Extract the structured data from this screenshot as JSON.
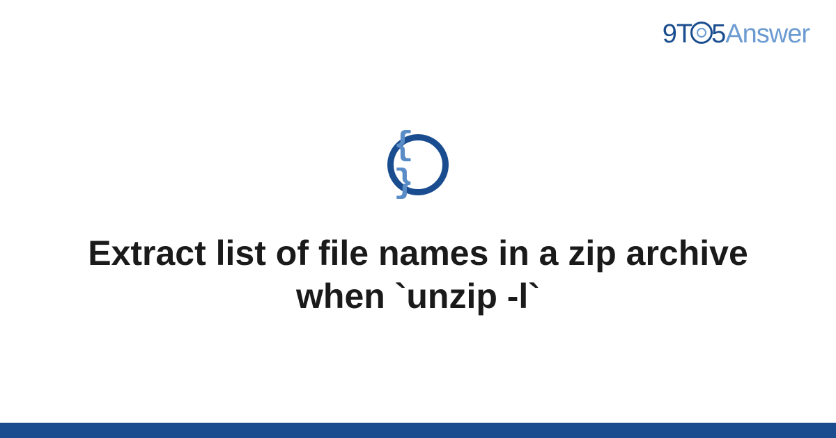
{
  "logo": {
    "part1": "9T",
    "part2": "5",
    "part3": "Answer"
  },
  "icon": {
    "glyph": "{ }"
  },
  "title": "Extract list of file names in a zip archive when `unzip -l`"
}
